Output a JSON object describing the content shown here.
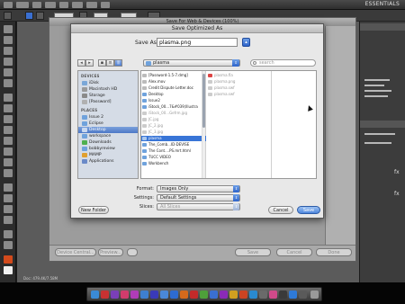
{
  "photoshop": {
    "workspace_switcher": "ESSENTIALS",
    "status_text": "Doc: 479.4K/7.58M"
  },
  "save_for_web": {
    "window_title": "Save For Web & Devices (100%)",
    "buttons": {
      "device_central": "Device Central...",
      "preview": "Preview...",
      "save": "Save",
      "cancel": "Cancel",
      "done": "Done"
    }
  },
  "dialog": {
    "title": "Save Optimized As",
    "save_as_label": "Save As:",
    "filename": "plasma.png",
    "location": "plasma",
    "search_placeholder": "search",
    "sidebar": {
      "devices_header": "DEVICES",
      "devices": [
        "iDisk",
        "Macintosh HD",
        "Storage",
        "[Password]"
      ],
      "places_header": "PLACES",
      "places": [
        "Issue 2",
        "Eclipse",
        "Desktop",
        "workspace",
        "Downloads",
        "bobbyreview",
        "MAMP",
        "Applications"
      ],
      "selected": "Desktop"
    },
    "column_1": {
      "items": [
        "[Password-1.5-7.dmg]",
        "Alex.mov",
        "Credit Dispute Letter.doc",
        "Desktop",
        "Issue2",
        "iStock_00...7&#039;Illustra",
        "iStock_00...Gefrm.jpg",
        "JC.jpg",
        "JC_2.jpg",
        "JC_3.jpg",
        "plasma",
        "The_Comb...ID-DEVISE",
        "The Cont....PS.mrt.html",
        "TUCC VIDEO",
        "Workbench"
      ],
      "selected": "plasma"
    },
    "column_2": {
      "items": [
        "plasma.fla",
        "plasma.png",
        "plasma.swf",
        "plasma.swf"
      ]
    },
    "options": {
      "format_label": "Format:",
      "format_value": "Images Only",
      "settings_label": "Settings:",
      "settings_value": "Default Settings",
      "slices_label": "Slices:",
      "slices_value": "All Slices"
    },
    "buttons": {
      "new_folder": "New Folder",
      "cancel": "Cancel",
      "save": "Save"
    }
  },
  "colors": {
    "selection_blue": "#3875d7",
    "dialog_bg": "#e8e8e8",
    "sidebar_bg": "#d5dce6"
  }
}
